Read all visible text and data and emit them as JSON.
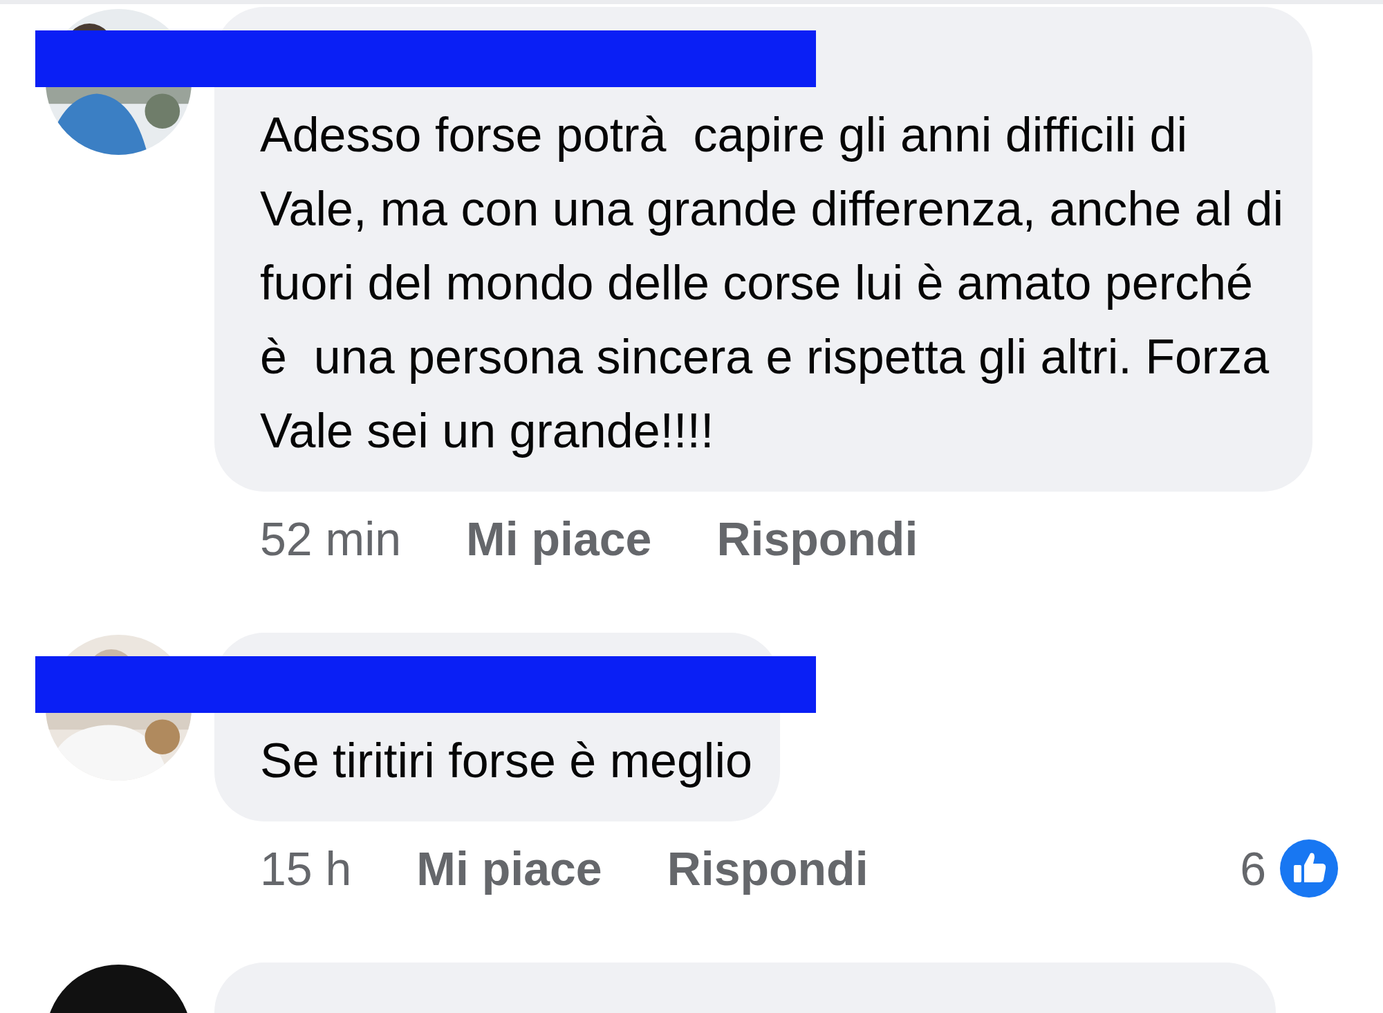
{
  "comments": [
    {
      "author_redacted": true,
      "text": "Adesso forse potrà  capire gli anni difficili di Vale, ma con una grande differenza, anche al di fuori del mondo delle corse lui è amato perché  è  una persona sincera e rispetta gli altri. Forza Vale sei un grande!!!!",
      "time": "52 min",
      "like_label": "Mi piace",
      "reply_label": "Rispondi"
    },
    {
      "author_redacted": true,
      "text": "Se tiritiri forse è meglio",
      "time": "15 h",
      "like_label": "Mi piace",
      "reply_label": "Rispondi",
      "reaction_count": "6"
    },
    {
      "author_redacted": false
    }
  ]
}
